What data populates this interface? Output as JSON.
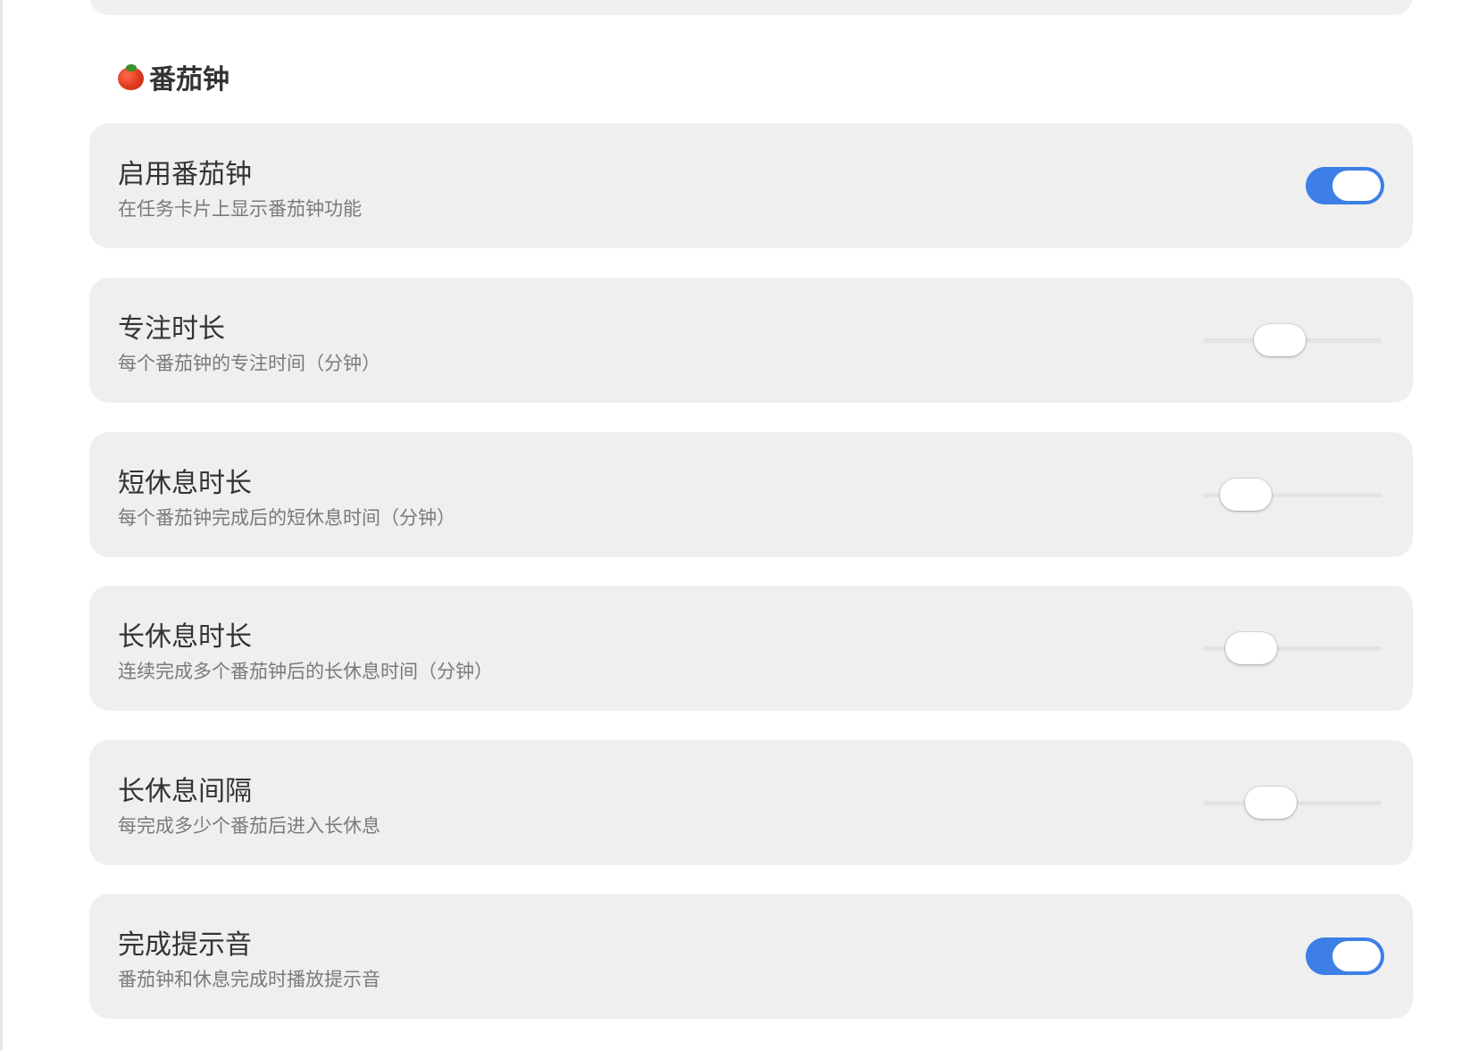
{
  "section": {
    "icon": "tomato-icon",
    "title": "番茄钟"
  },
  "settings": [
    {
      "id": "enable",
      "title": "启用番茄钟",
      "description": "在任务卡片上显示番茄钟功能",
      "control": "toggle",
      "checked": true
    },
    {
      "id": "focus",
      "title": "专注时长",
      "description": "每个番茄钟的专注时间（分钟）",
      "control": "slider",
      "level": 0.43
    },
    {
      "id": "short-break",
      "title": "短休息时长",
      "description": "每个番茄钟完成后的短休息时间（分钟）",
      "control": "slider",
      "level": 0.24
    },
    {
      "id": "long-break",
      "title": "长休息时长",
      "description": "连续完成多个番茄钟后的长休息时间（分钟）",
      "control": "slider",
      "level": 0.27
    },
    {
      "id": "long-break-interval",
      "title": "长休息间隔",
      "description": "每完成多少个番茄后进入长休息",
      "control": "slider",
      "level": 0.38
    },
    {
      "id": "sound",
      "title": "完成提示音",
      "description": "番茄钟和休息完成时播放提示音",
      "control": "toggle",
      "checked": true
    }
  ],
  "colors": {
    "accent": "#3d7fe6",
    "card": "#efefef",
    "title": "#333333",
    "description": "#7a7a7a"
  }
}
